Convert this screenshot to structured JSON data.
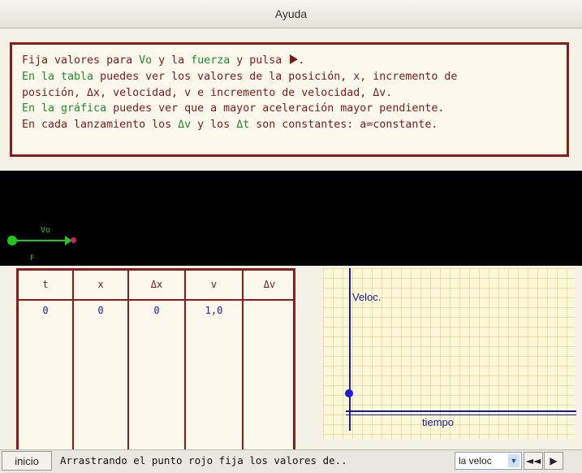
{
  "titlebar": {
    "title": "Ayuda"
  },
  "help": {
    "l1a": "Fija valores para ",
    "l1b": "Vo",
    "l1c": " y  la ",
    "l1d": "fuerza",
    "l1e": " y pulsa ",
    "l1f": ".",
    "l2a": "En la tabla",
    "l2b": " puedes ver los valores de la posición, x, incremento de",
    "l3": "posición, Δx, velocidad, v e incremento de velocidad, Δv.",
    "l4a": "En la gráfica",
    "l4b": " puedes ver que a mayor aceleración mayor pendiente.",
    "l5a": "En cada lanzamiento los ",
    "l5b": "Δv",
    "l5c": " y los ",
    "l5d": "Δt",
    "l5e": " son constantes: a=constante."
  },
  "sim": {
    "vo_label": "Vo",
    "f_label": "F"
  },
  "table": {
    "headers": [
      "t",
      "x",
      "Δx",
      "v",
      "Δv"
    ],
    "rows": [
      [
        "0",
        "0",
        "0",
        "1,0",
        ""
      ]
    ]
  },
  "graph": {
    "ylabel": "Veloc.",
    "xlabel": "tiempo"
  },
  "bottom": {
    "inicio": "inicio",
    "message": "Arrastrando el punto rojo fija los valores de..",
    "select_value": "la veloc",
    "prev_label": "◄◄",
    "play_label": "▶"
  },
  "colors": {
    "accent_red": "#8a1c1c",
    "text_green": "#1f8a2d",
    "axis_blue": "#1a1aa0"
  }
}
